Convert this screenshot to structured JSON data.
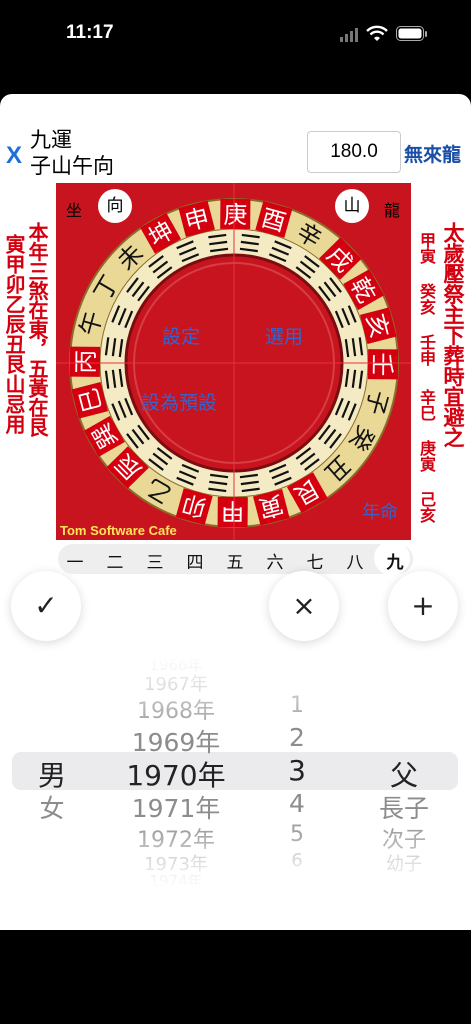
{
  "status_bar": {
    "time": "11:17"
  },
  "header": {
    "close_label": "X",
    "title_line1": "九運",
    "title_line2": "子山午向",
    "degree_value": "180.0",
    "mode_label": "無來龍"
  },
  "side_text": {
    "left_outer": "寅甲卯乙辰丑艮山忌用",
    "left_inner": "本年三煞在東，五黃在艮",
    "right_inner": "太歲壓祭主下葬時宜避之",
    "right_outer_1": "甲寅 癸亥 壬申",
    "right_outer_2": "辛巳 庚寅 己亥"
  },
  "compass": {
    "sit_label": "坐",
    "face_label": "向",
    "mountain_label": "山",
    "dragon_label": "龍",
    "set_button": "設定",
    "select_button": "選用",
    "default_button": "設為預設",
    "year_life_button": "年命",
    "brand": "Tom Software Cafe",
    "ring_chars": [
      "丙",
      "午",
      "丁",
      "未",
      "坤",
      "申",
      "庚",
      "酉",
      "辛",
      "戌",
      "乾",
      "亥",
      "壬",
      "子",
      "癸",
      "丑",
      "艮",
      "寅",
      "甲",
      "卯",
      "乙",
      "辰",
      "巽",
      "巳"
    ],
    "highlight_colors": {
      "red": "#d4000f",
      "gold": "#e7d48a",
      "blue": "#3a62c8"
    }
  },
  "yun_selector": {
    "items": [
      "一",
      "二",
      "三",
      "四",
      "五",
      "六",
      "七",
      "八",
      "九"
    ],
    "selected": "九"
  },
  "actions": {
    "confirm_icon": "✓",
    "cancel_icon": "×",
    "add_icon": "+"
  },
  "picker": {
    "gender": {
      "selected": "男",
      "below": [
        "女"
      ]
    },
    "year": {
      "above": [
        "1966年",
        "1967年",
        "1968年",
        "1969年"
      ],
      "selected": "1970年",
      "below": [
        "1971年",
        "1972年",
        "1973年",
        "1974年"
      ]
    },
    "number": {
      "above": [
        "1",
        "2"
      ],
      "selected": "3",
      "below": [
        "4",
        "5",
        "6"
      ]
    },
    "relation": {
      "selected": "父",
      "below": [
        "長子",
        "次子",
        "幼子"
      ]
    }
  }
}
